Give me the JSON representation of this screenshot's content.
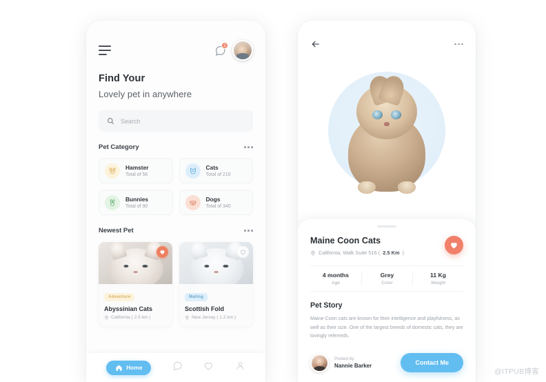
{
  "home": {
    "menu_icon": "hamburger-menu-icon",
    "chat_icon": "chat-bubble-icon",
    "notification_count": "2",
    "avatar": "user-avatar",
    "heading_line1": "Find Your",
    "heading_line2": "Lovely pet in anywhere",
    "search": {
      "placeholder": "Search",
      "icon": "search-icon"
    },
    "category_section": {
      "title": "Pet Category",
      "more_icon": "more-dots-icon"
    },
    "categories": [
      {
        "name": "Hamster",
        "total": "Total of 56",
        "color": "#fcf3dc",
        "icon": "hamster-icon"
      },
      {
        "name": "Cats",
        "total": "Total of 210",
        "color": "#ddeefb",
        "icon": "cat-icon"
      },
      {
        "name": "Bunnies",
        "total": "Total of 90",
        "color": "#e3f4e5",
        "icon": "bunny-icon"
      },
      {
        "name": "Dogs",
        "total": "Total of 340",
        "color": "#fbdfd4",
        "icon": "dog-icon"
      }
    ],
    "newest_section": {
      "title": "Newest Pet",
      "more_icon": "more-dots-icon"
    },
    "pets": [
      {
        "tag": "Adventure",
        "name": "Abyssinian Cats",
        "location": "California ( 2.5 km )",
        "favorited": "true"
      },
      {
        "tag": "Mating",
        "name": "Scottish Fold",
        "location": "New Jersey ( 1.2 km )",
        "favorited": "false"
      }
    ],
    "nav": [
      {
        "label": "Home",
        "icon": "home-icon",
        "active": "true"
      },
      {
        "label": "Chat",
        "icon": "chat-icon",
        "active": "false"
      },
      {
        "label": "Favorites",
        "icon": "heart-icon",
        "active": "false"
      },
      {
        "label": "Profile",
        "icon": "person-icon",
        "active": "false"
      }
    ]
  },
  "detail": {
    "back_icon": "back-arrow-icon",
    "more_icon": "more-dots-icon",
    "hero_image": "maine-coon-kitten-photo",
    "title": "Maine Coon Cats",
    "location_prefix": "California,  Walk Suite 516 (",
    "location_distance": "2.5 Km",
    "location_suffix": ")",
    "like_icon": "heart-icon",
    "stats": [
      {
        "value": "4 months",
        "label": "Age"
      },
      {
        "value": "Grey",
        "label": "Color"
      },
      {
        "value": "11 Kg",
        "label": "Weight"
      }
    ],
    "story_title": "Pet Story",
    "story_body": "Maine Coon cats are known for their intelligence and playfulness, as well as their size. One of the largest breeds of domestic cats, they are lovingly referreds.",
    "posted_by_label": "Posted by",
    "posted_by_name": "Nannie Barker",
    "contact_label": "Contact Me"
  },
  "colors": {
    "primary_blue": "#62bdf0",
    "accent_orange": "#f0806a"
  },
  "watermark": "@ITPUB博客"
}
